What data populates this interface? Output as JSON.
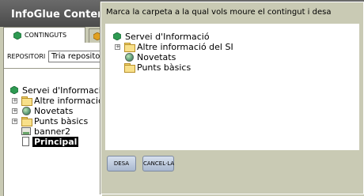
{
  "app": {
    "title": "InfoGlue Content"
  },
  "tabs": [
    {
      "label": "CONTINGUTS"
    }
  ],
  "repository": {
    "label": "REPOSITORI",
    "selected": "Tria repositori"
  },
  "tree": {
    "root": "Servei d'Informació",
    "items": [
      {
        "label": "Altre informació d",
        "icon": "folder-icon",
        "expandable": true
      },
      {
        "label": "Novetats",
        "icon": "globe-icon",
        "expandable": true
      },
      {
        "label": "Punts bàsics",
        "icon": "folder-icon",
        "expandable": true
      },
      {
        "label": "banner2",
        "icon": "image-icon",
        "expandable": false
      },
      {
        "label": "Principal",
        "icon": "page-icon",
        "expandable": false,
        "selected": true
      }
    ]
  },
  "dialog": {
    "message": "Marca la carpeta a la qual vols moure el contingut i desa",
    "tree": {
      "root": "Servei d'Informació",
      "items": [
        {
          "label": "Altre informació del SI",
          "icon": "folder-icon",
          "expandable": true
        },
        {
          "label": "Novetats",
          "icon": "globe-icon",
          "expandable": false
        },
        {
          "label": "Punts bàsics",
          "icon": "folder-icon",
          "expandable": false
        }
      ]
    },
    "save_label": "DESA",
    "cancel_label": "CANCEL·LA"
  },
  "colors": {
    "background": "#c9cab4",
    "titlebar": "#555555",
    "button": "#b8c6da",
    "gem": "#2e9a52"
  }
}
